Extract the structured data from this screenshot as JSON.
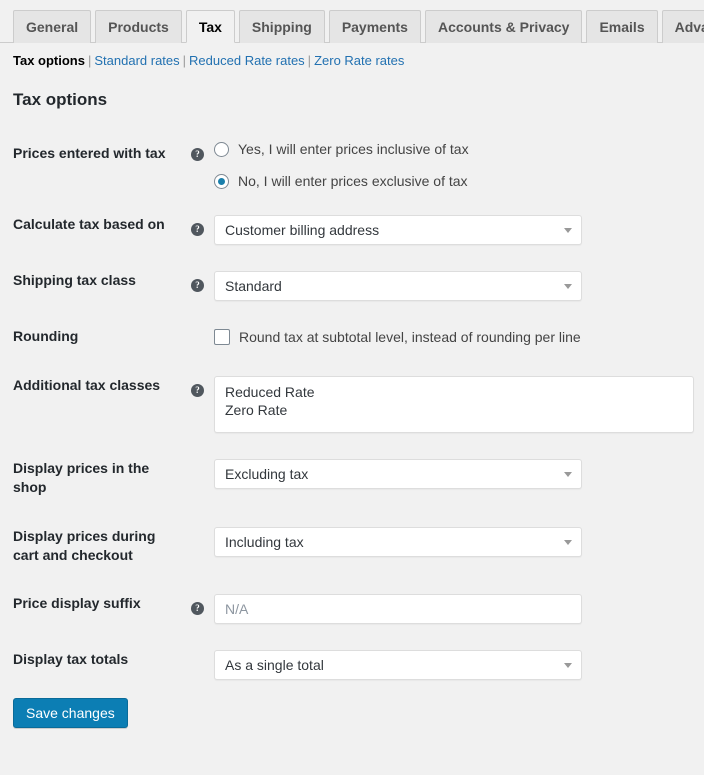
{
  "tabs": [
    {
      "label": "General",
      "active": false
    },
    {
      "label": "Products",
      "active": false
    },
    {
      "label": "Tax",
      "active": true
    },
    {
      "label": "Shipping",
      "active": false
    },
    {
      "label": "Payments",
      "active": false
    },
    {
      "label": "Accounts & Privacy",
      "active": false
    },
    {
      "label": "Emails",
      "active": false
    },
    {
      "label": "Advanced",
      "active": false
    }
  ],
  "subnav": {
    "current": "Tax options",
    "links": [
      "Standard rates",
      "Reduced Rate rates",
      "Zero Rate rates"
    ],
    "separator": "|"
  },
  "section": {
    "title": "Tax options"
  },
  "help_icon": "?",
  "rows": {
    "prices_entered_with_tax": {
      "label": "Prices entered with tax",
      "help": "help-icon",
      "options": [
        {
          "label": "Yes, I will enter prices inclusive of tax",
          "selected": false
        },
        {
          "label": "No, I will enter prices exclusive of tax",
          "selected": true
        }
      ]
    },
    "calculate_tax_based_on": {
      "label": "Calculate tax based on",
      "value": "Customer billing address"
    },
    "shipping_tax_class": {
      "label": "Shipping tax class",
      "value": "Standard"
    },
    "rounding": {
      "label": "Rounding",
      "checkbox_label": "Round tax at subtotal level, instead of rounding per line",
      "checked": false
    },
    "additional_tax_classes": {
      "label": "Additional tax classes",
      "value": "Reduced Rate\nZero Rate"
    },
    "display_prices_shop": {
      "label": "Display prices in the shop",
      "value": "Excluding tax"
    },
    "display_prices_cart": {
      "label": "Display prices during cart and checkout",
      "value": "Including tax"
    },
    "price_display_suffix": {
      "label": "Price display suffix",
      "value": "",
      "placeholder": "N/A"
    },
    "display_tax_totals": {
      "label": "Display tax totals",
      "value": "As a single total"
    }
  },
  "submit": {
    "label": "Save changes"
  },
  "colors": {
    "accent": "#0c7eb4",
    "link": "#2271b1",
    "radio_selected": "#1a7fab",
    "page_bg": "#f1f1f1",
    "tab_bg": "#e5e5e5"
  }
}
